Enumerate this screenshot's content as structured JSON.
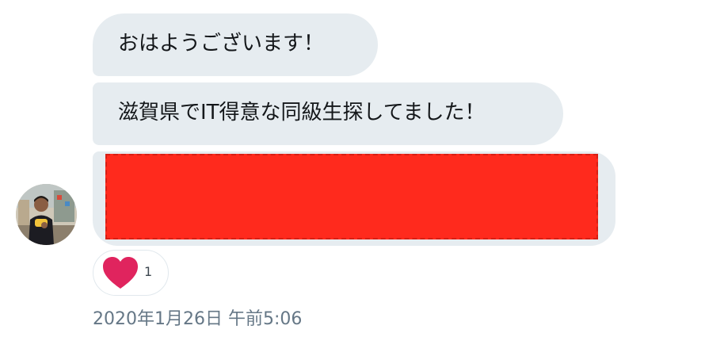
{
  "messages": [
    {
      "text": "おはようございます！"
    },
    {
      "text": "滋賀県でIT得意な同級生探してました！"
    },
    {
      "redacted": true,
      "redaction_color": "#ff2a1d"
    }
  ],
  "reaction": {
    "icon": "heart-icon",
    "icon_color": "#e0245e",
    "count": "1"
  },
  "timestamp": "2020年1月26日 午前5:06",
  "colors": {
    "bubble_background": "#e6ecf0",
    "text": "#14171a",
    "timestamp": "#657786"
  }
}
